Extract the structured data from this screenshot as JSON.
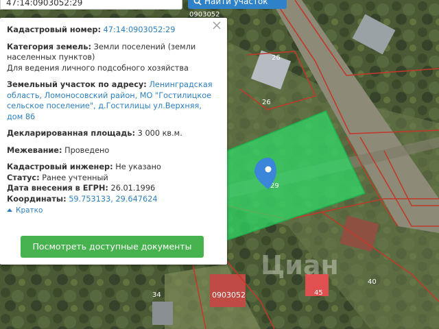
{
  "search": {
    "value": "47:14:0903052:29",
    "button_label": "Найти участок"
  },
  "map": {
    "cadastral_block": "0903052",
    "labels": [
      "0903052",
      "26",
      "26",
      "29",
      "34",
      "40",
      "45",
      "0903052"
    ]
  },
  "panel": {
    "cadastral_number": {
      "label": "Кадастровый номер:",
      "value": "47:14:0903052:29"
    },
    "land_category": {
      "label": "Категория земель:",
      "value_line1": "Земли поселений (земли",
      "value_line2": "населенных пунктов)",
      "purpose": "Для ведения личного подсобного хозяйства"
    },
    "address": {
      "label": "Земельный участок по адресу:",
      "line1": "Ленинградская",
      "line2": "область, Ломоносовский район, МО \"Гостилицкое",
      "line3": "сельское поселение\", д.Гостилицы ул.Верхняя,",
      "line4": "дом 86"
    },
    "declared_area": {
      "label": "Декларированная площадь:",
      "value": "3 000 кв.м."
    },
    "surveying": {
      "label": "Межевание:",
      "value": "Проведено"
    },
    "engineer": {
      "label": "Кадастровый инженер:",
      "value": "Не указано"
    },
    "status": {
      "label": "Статус:",
      "value": "Ранее учтенный"
    },
    "egrn_date": {
      "label": "Дата внесения в ЕГРН:",
      "value": "26.01.1996"
    },
    "coordinates": {
      "label": "Координаты:",
      "value": "59.753133, 29.647624"
    },
    "brief_link": "Кратко",
    "docs_button": "Посмотреть доступные документы"
  },
  "watermark": "Циан",
  "colors": {
    "link": "#2f7fc0",
    "accent_button": "#47b34f",
    "search_button": "#2f82c8",
    "parcel_fill": "#2ee06a",
    "boundary": "#c0392b",
    "marker": "#3b86d8"
  },
  "icons": [
    "search-icon",
    "close-icon",
    "map-marker-icon",
    "chevron-up-icon"
  ]
}
